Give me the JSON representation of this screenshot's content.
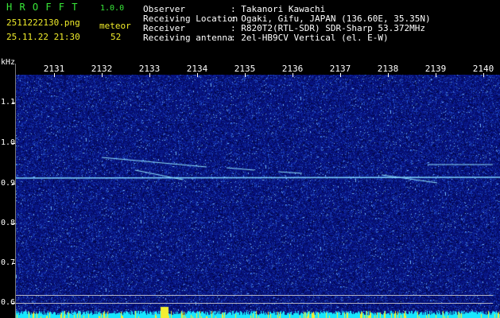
{
  "header": {
    "app_name": "H R O F F T",
    "version": "1.0.0",
    "filename": "2511222130.png",
    "datetime": "25.11.22 21:30",
    "meteor_label": "meteor",
    "meteor_count": "52",
    "info_labels": [
      "Observer",
      "Receiving Location",
      "Receiver",
      "Receiving antenna"
    ],
    "info_values": [
      ": Takanori Kawachi",
      ": Ogaki, Gifu, JAPAN (136.60E, 35.35N)",
      ": R820T2(RTL-SDR) SDR-Sharp 53.372MHz",
      ": 2el-HB9CV Vertical (el. E-W)"
    ]
  },
  "y_axis": {
    "unit": "kHz",
    "ticks": [
      "1.1",
      "1.0",
      "0.9",
      "0.8",
      "0.7",
      "0.6"
    ]
  },
  "x_axis": {
    "ticks": [
      "2131",
      "2132",
      "2133",
      "2134",
      "2135",
      "2136",
      "2137",
      "2138",
      "2139",
      "2140"
    ]
  },
  "colors": {
    "background": "#06107a",
    "signal": "#6ad8ff",
    "header_green": "#38e838",
    "header_yellow": "#f0ec2a"
  }
}
